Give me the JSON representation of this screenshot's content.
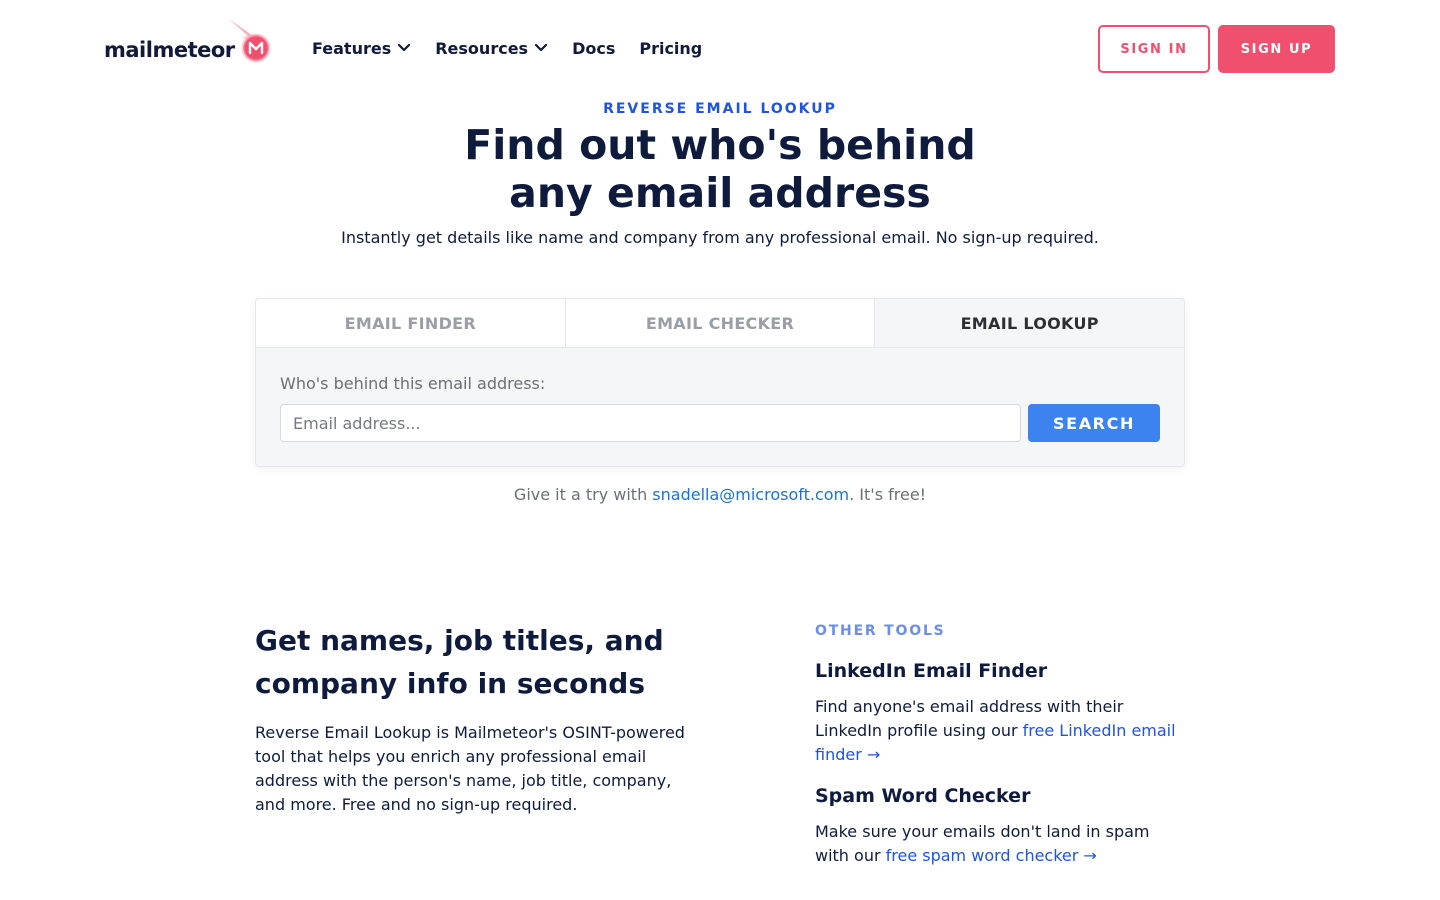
{
  "brand": {
    "name": "mailmeteor",
    "accent": "#f0506e",
    "link_blue": "#1e54e0",
    "button_blue": "#3d83f0"
  },
  "nav": {
    "items": [
      {
        "label": "Features",
        "has_dropdown": true,
        "icon": "chevron-down-icon"
      },
      {
        "label": "Resources",
        "has_dropdown": true,
        "icon": "chevron-down-icon"
      },
      {
        "label": "Docs",
        "has_dropdown": false
      },
      {
        "label": "Pricing",
        "has_dropdown": false
      }
    ],
    "sign_in": "SIGN IN",
    "sign_up": "SIGN UP"
  },
  "hero": {
    "eyebrow": "REVERSE EMAIL LOOKUP",
    "title_line1": "Find out who's behind",
    "title_line2": "any email address",
    "subtitle": "Instantly get details like name and company from any professional email. No sign-up required."
  },
  "tool": {
    "tabs": [
      {
        "label": "EMAIL FINDER",
        "active": false
      },
      {
        "label": "EMAIL CHECKER",
        "active": false
      },
      {
        "label": "EMAIL LOOKUP",
        "active": true
      }
    ],
    "field_label": "Who's behind this email address:",
    "input_value": "",
    "input_placeholder": "Email address...",
    "search_label": "SEARCH"
  },
  "try": {
    "prefix": "Give it a try with ",
    "example_email": "snadella@microsoft.com",
    "suffix": ". It's free!"
  },
  "feature": {
    "title_line1": "Get names, job titles, and",
    "title_line2": "company info in seconds",
    "body": "Reverse Email Lookup is Mailmeteor's OSINT-powered tool that helps you enrich any professional email address with the person's name, job title, company, and more. Free and no sign-up required."
  },
  "other_tools": {
    "eyebrow": "OTHER TOOLS",
    "items": [
      {
        "title": "LinkedIn Email Finder",
        "desc": "Find anyone's email address with their LinkedIn profile using our ",
        "link": "free LinkedIn email finder →"
      },
      {
        "title": "Spam Word Checker",
        "desc": "Make sure your emails don't land in spam with our ",
        "link": "free spam word checker →"
      }
    ]
  }
}
